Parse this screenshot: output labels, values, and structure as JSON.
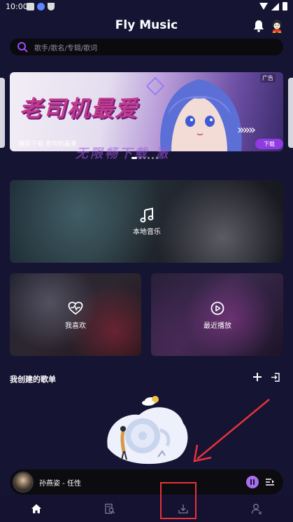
{
  "status_bar": {
    "time": "10:00"
  },
  "header": {
    "title": "Fly Music"
  },
  "search": {
    "placeholder": "歌手/歌名/专辑/歌词"
  },
  "banner": {
    "headline": "老司机最爱",
    "subtitle": "蒲荷下载·老司机最爱",
    "ad_label": "广告",
    "download_label": "下载",
    "overflow_text": "无限畅下载 激"
  },
  "cards": {
    "local": {
      "label": "本地音乐",
      "icon": "music-note-icon"
    },
    "favorites": {
      "label": "我喜欢",
      "icon": "heart-pulse-icon"
    },
    "recent": {
      "label": "最近播放",
      "icon": "play-circle-icon"
    }
  },
  "section": {
    "title": "我创建的歌单"
  },
  "mini_player": {
    "title": "孙燕姿 - 任性"
  },
  "tabs": [
    {
      "name": "home",
      "icon": "home-icon"
    },
    {
      "name": "discover",
      "icon": "document-search-icon"
    },
    {
      "name": "download",
      "icon": "download-icon"
    },
    {
      "name": "profile",
      "icon": "user-icon"
    }
  ],
  "colors": {
    "background": "#161433",
    "accent": "#a86ef0",
    "annotation": "#e8323a"
  }
}
